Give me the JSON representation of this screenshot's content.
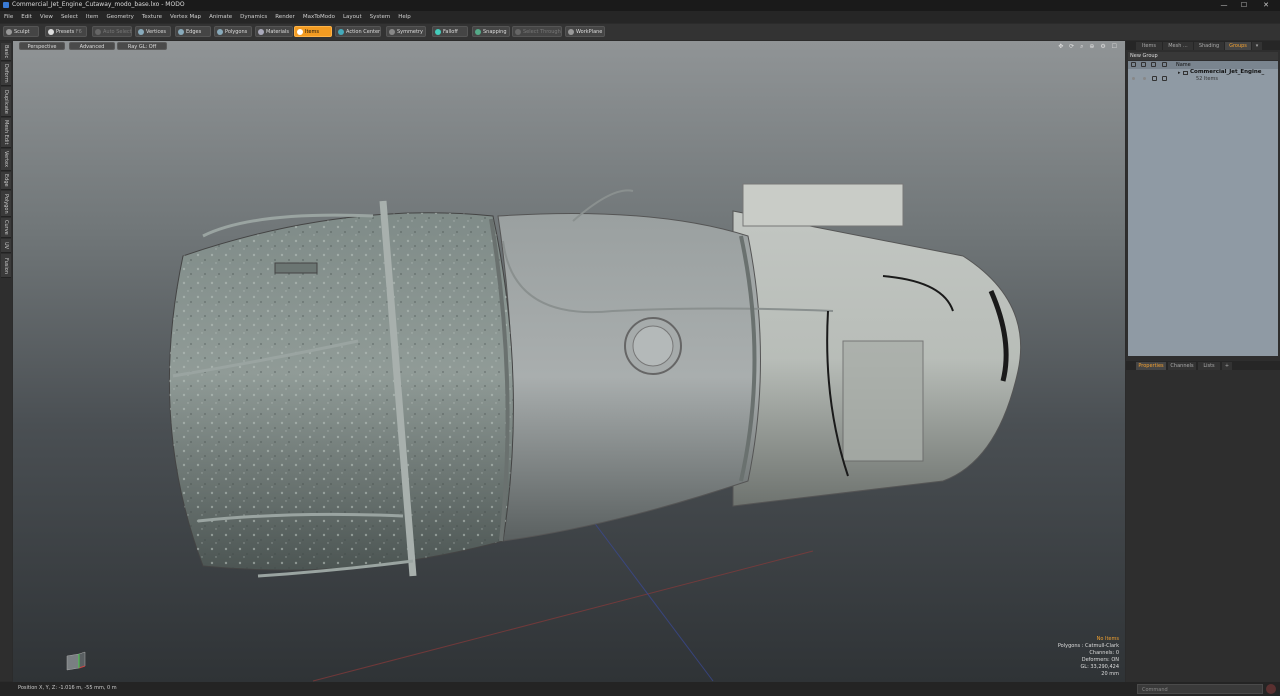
{
  "window": {
    "title": "Commercial_Jet_Engine_Cutaway_modo_base.lxo - MODO"
  },
  "menu": [
    "File",
    "Edit",
    "View",
    "Select",
    "Item",
    "Geometry",
    "Texture",
    "Vertex Map",
    "Animate",
    "Dynamics",
    "Render",
    "MaxToModo",
    "Layout",
    "System",
    "Help"
  ],
  "toolbar": {
    "sculpt": "Sculpt",
    "presets": "Presets",
    "presets_key": "F6",
    "auto_select": "Auto Select",
    "vertices": "Vertices",
    "edges": "Edges",
    "polygons": "Polygons",
    "materials": "Materials",
    "items": "Items",
    "action_center": "Action Center",
    "symmetry": "Symmetry",
    "falloff": "Falloff",
    "snapping": "Snapping",
    "select_through": "Select Through",
    "workplane": "WorkPlane"
  },
  "left_tabs": [
    "Basic",
    "Deform",
    "Duplicate",
    "Mesh Edit",
    "Vertex",
    "Edge",
    "Polygon",
    "Curve",
    "UV",
    "Fusion"
  ],
  "viewport": {
    "view_mode": "Perspective",
    "shading": "Advanced",
    "ray_gl": "Ray GL: Off"
  },
  "stats": {
    "no_items": "No Items",
    "polygons": "Polygons : Catmull-Clark",
    "channels": "Channels: 0",
    "deformers": "Deformers: ON",
    "gl": "GL: 33,290,424",
    "unit": "20 mm"
  },
  "right_tabs_top": [
    "Items",
    "Mesh ...",
    "Shading",
    "Groups"
  ],
  "active_top_tab": "Groups",
  "groups": {
    "new_group": "New Group",
    "column_name": "Name",
    "item_name": "Commercial_Jet_Engine_",
    "item_count": "52 Items"
  },
  "right_tabs_bottom": [
    "Properties",
    "Channels",
    "Lists"
  ],
  "statusbar": {
    "position": "Position X, Y, Z:   -1.016 m, -55 mm, 0 m",
    "command_placeholder": "Command"
  },
  "colors": {
    "accent": "#f29b22",
    "viewport_top": "#909496",
    "viewport_bottom": "#2f3336",
    "engine_body": "#8a9490"
  }
}
